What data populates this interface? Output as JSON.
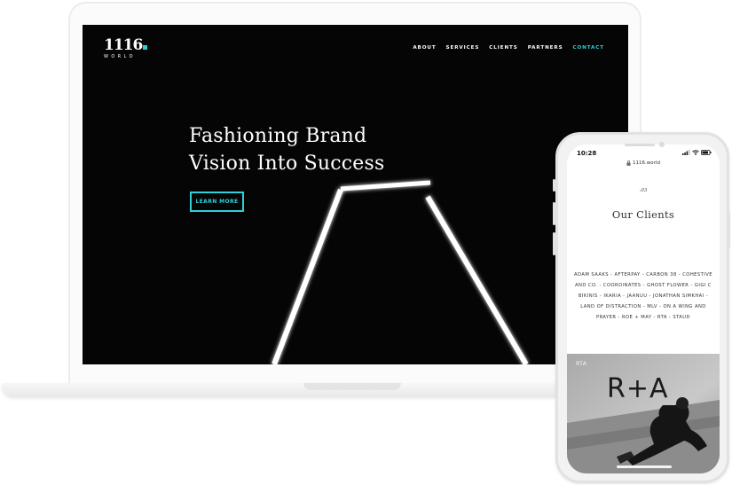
{
  "desktop_site": {
    "logo": {
      "main": "1116",
      "sub": "WORLD",
      "accent_color": "#2fd0d6"
    },
    "nav": [
      {
        "label": "ABOUT",
        "active": false
      },
      {
        "label": "SERVICES",
        "active": false
      },
      {
        "label": "CLIENTS",
        "active": false
      },
      {
        "label": "PARTNERS",
        "active": false
      },
      {
        "label": "CONTACT",
        "active": true
      }
    ],
    "hero": {
      "title_line1": "Fashioning Brand",
      "title_line2": "Vision Into Success",
      "button_label": "LEARN MORE"
    }
  },
  "mobile_site": {
    "status": {
      "time": "10:28"
    },
    "url": "1116.world",
    "section_number": ".03",
    "section_title": "Our Clients",
    "clients_text": "ADAM SAAKS - AFTERPAY - CARBON 38 - COHESTIVE AND CO. - COORDINATES - GHOST FLOWER - GIGI C BIKINIS - IKARIA - JAANUU - JONATHAN SIMKHAI - LAND OF DISTRACTION - MLV - ON A WING AND PRAYER - ROE + MAY - RTA - STAUD",
    "card": {
      "label": "RTA",
      "logo": "R+A"
    }
  },
  "colors": {
    "accent": "#2fd0d6",
    "hero_background": "#050505",
    "device_frame": "#e2e2e2"
  }
}
